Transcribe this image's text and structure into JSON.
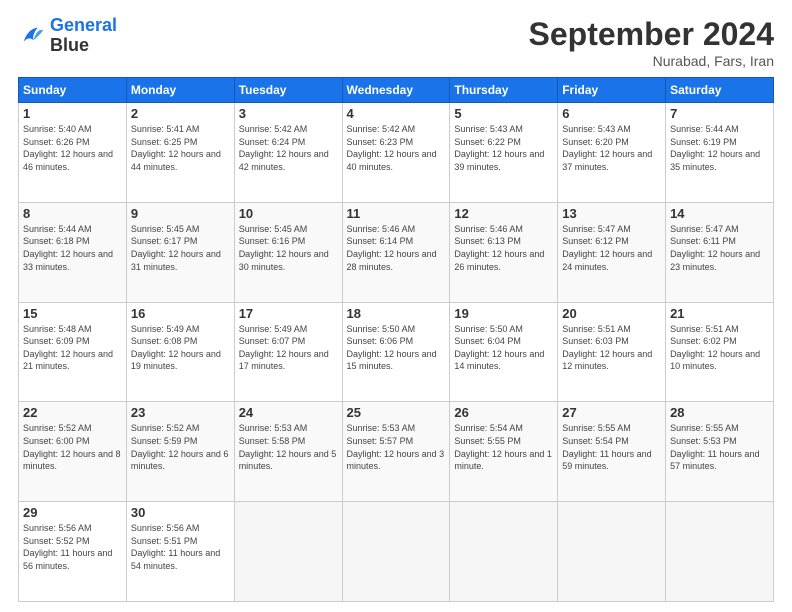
{
  "header": {
    "logo_line1": "General",
    "logo_line2": "Blue",
    "month_title": "September 2024",
    "location": "Nurabad, Fars, Iran"
  },
  "weekdays": [
    "Sunday",
    "Monday",
    "Tuesday",
    "Wednesday",
    "Thursday",
    "Friday",
    "Saturday"
  ],
  "weeks": [
    [
      {
        "day": "1",
        "sunrise": "5:40 AM",
        "sunset": "6:26 PM",
        "daylight": "12 hours and 46 minutes."
      },
      {
        "day": "2",
        "sunrise": "5:41 AM",
        "sunset": "6:25 PM",
        "daylight": "12 hours and 44 minutes."
      },
      {
        "day": "3",
        "sunrise": "5:42 AM",
        "sunset": "6:24 PM",
        "daylight": "12 hours and 42 minutes."
      },
      {
        "day": "4",
        "sunrise": "5:42 AM",
        "sunset": "6:23 PM",
        "daylight": "12 hours and 40 minutes."
      },
      {
        "day": "5",
        "sunrise": "5:43 AM",
        "sunset": "6:22 PM",
        "daylight": "12 hours and 39 minutes."
      },
      {
        "day": "6",
        "sunrise": "5:43 AM",
        "sunset": "6:20 PM",
        "daylight": "12 hours and 37 minutes."
      },
      {
        "day": "7",
        "sunrise": "5:44 AM",
        "sunset": "6:19 PM",
        "daylight": "12 hours and 35 minutes."
      }
    ],
    [
      {
        "day": "8",
        "sunrise": "5:44 AM",
        "sunset": "6:18 PM",
        "daylight": "12 hours and 33 minutes."
      },
      {
        "day": "9",
        "sunrise": "5:45 AM",
        "sunset": "6:17 PM",
        "daylight": "12 hours and 31 minutes."
      },
      {
        "day": "10",
        "sunrise": "5:45 AM",
        "sunset": "6:16 PM",
        "daylight": "12 hours and 30 minutes."
      },
      {
        "day": "11",
        "sunrise": "5:46 AM",
        "sunset": "6:14 PM",
        "daylight": "12 hours and 28 minutes."
      },
      {
        "day": "12",
        "sunrise": "5:46 AM",
        "sunset": "6:13 PM",
        "daylight": "12 hours and 26 minutes."
      },
      {
        "day": "13",
        "sunrise": "5:47 AM",
        "sunset": "6:12 PM",
        "daylight": "12 hours and 24 minutes."
      },
      {
        "day": "14",
        "sunrise": "5:47 AM",
        "sunset": "6:11 PM",
        "daylight": "12 hours and 23 minutes."
      }
    ],
    [
      {
        "day": "15",
        "sunrise": "5:48 AM",
        "sunset": "6:09 PM",
        "daylight": "12 hours and 21 minutes."
      },
      {
        "day": "16",
        "sunrise": "5:49 AM",
        "sunset": "6:08 PM",
        "daylight": "12 hours and 19 minutes."
      },
      {
        "day": "17",
        "sunrise": "5:49 AM",
        "sunset": "6:07 PM",
        "daylight": "12 hours and 17 minutes."
      },
      {
        "day": "18",
        "sunrise": "5:50 AM",
        "sunset": "6:06 PM",
        "daylight": "12 hours and 15 minutes."
      },
      {
        "day": "19",
        "sunrise": "5:50 AM",
        "sunset": "6:04 PM",
        "daylight": "12 hours and 14 minutes."
      },
      {
        "day": "20",
        "sunrise": "5:51 AM",
        "sunset": "6:03 PM",
        "daylight": "12 hours and 12 minutes."
      },
      {
        "day": "21",
        "sunrise": "5:51 AM",
        "sunset": "6:02 PM",
        "daylight": "12 hours and 10 minutes."
      }
    ],
    [
      {
        "day": "22",
        "sunrise": "5:52 AM",
        "sunset": "6:00 PM",
        "daylight": "12 hours and 8 minutes."
      },
      {
        "day": "23",
        "sunrise": "5:52 AM",
        "sunset": "5:59 PM",
        "daylight": "12 hours and 6 minutes."
      },
      {
        "day": "24",
        "sunrise": "5:53 AM",
        "sunset": "5:58 PM",
        "daylight": "12 hours and 5 minutes."
      },
      {
        "day": "25",
        "sunrise": "5:53 AM",
        "sunset": "5:57 PM",
        "daylight": "12 hours and 3 minutes."
      },
      {
        "day": "26",
        "sunrise": "5:54 AM",
        "sunset": "5:55 PM",
        "daylight": "12 hours and 1 minute."
      },
      {
        "day": "27",
        "sunrise": "5:55 AM",
        "sunset": "5:54 PM",
        "daylight": "11 hours and 59 minutes."
      },
      {
        "day": "28",
        "sunrise": "5:55 AM",
        "sunset": "5:53 PM",
        "daylight": "11 hours and 57 minutes."
      }
    ],
    [
      {
        "day": "29",
        "sunrise": "5:56 AM",
        "sunset": "5:52 PM",
        "daylight": "11 hours and 56 minutes."
      },
      {
        "day": "30",
        "sunrise": "5:56 AM",
        "sunset": "5:51 PM",
        "daylight": "11 hours and 54 minutes."
      },
      null,
      null,
      null,
      null,
      null
    ]
  ]
}
